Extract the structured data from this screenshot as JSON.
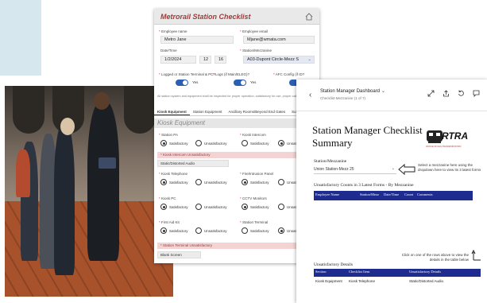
{
  "checklist": {
    "title": "Metrorail Station Checklist",
    "employee_name_label": "Employee name",
    "employee_name": "Metro Jane",
    "employee_email_label": "Employee email",
    "employee_email": "Mjane@wmata.com",
    "datetime_label": "Date/Time",
    "date": "1/2/2024",
    "hour": "12",
    "minute": "16",
    "station_label": "Station/Mezzanine",
    "station": "A03-Dupont Circle-Mezz S",
    "logged_label": "Logged or Station Terminal & PC?",
    "logs_label": "Logs (if Main/ELEG)?",
    "afc_label": "AFC Config (if ID?",
    "yes1": "Yes",
    "yes2": "Yes",
    "note": "All station system and equipment shall be inspected for proper operation, satisfactory for use, proper calibration, and the above.",
    "tabs": [
      "Kiosk Equipment",
      "Station Equipment",
      "Ancillary Rooms/Beyond End Gates",
      "Subst"
    ],
    "section": "Kiosk Equipment",
    "station_pa": "Station PA",
    "kiosk_intercom": "Kiosk Intercom",
    "satisfactory": "Satisfactory",
    "unsatisfactory": "Unsatisfactory",
    "unsat_short": "Unsat",
    "kiosk_intercom_unsat": "Kiosk Intercom Unsatisfactory",
    "kiosk_intercom_unsat_val": "Static/Distorted Audio",
    "kiosk_telephone": "Kiosk Telephone",
    "fire_panel": "Fire/Intrusion Panel",
    "kiosk_pc": "Kiosk PC",
    "cctv": "CCTV Monitors",
    "first_aid": "First Aid Kit",
    "station_terminal": "Station Terminal",
    "station_terminal_unsat": "Station Terminal Unsatisfactory",
    "station_terminal_unsat_val": "Blank Screen"
  },
  "dashboard": {
    "app_title": "Station Manager Dashboard",
    "app_subtitle": "Checklist-Mezzanine (1 of 7)",
    "title_line1": "Station Manager Checklist",
    "title_line2": "Summary",
    "logo_text": "RTRA",
    "logo_sub": "OFFICE OF RAIL TRANSPORTATION",
    "station_label": "Station/Mezzanine",
    "station_value": "Union Station-Mezz 25",
    "hint1": "Select a mezzanine here using the dropdown here to view its 3 latest forms",
    "counts_heading": "Unsatisfactory Counts in 3 Latest Forms - By Mezzanine",
    "counts_cols": [
      "Employee Name",
      "Station/Mezz",
      "Date/Time",
      "Count",
      "Comments"
    ],
    "hint2": "Click on one of the rows above to view the details in the table below",
    "details_heading": "Unsatisfactory Details",
    "details_cols": [
      "Section",
      "Checklist Item",
      "Unsatisfactory Details"
    ],
    "details_row": [
      "Kiosk Equipment",
      "Kiosk Telephone",
      "Static/Distorted Audio"
    ]
  },
  "colors": {
    "accent": "#2a5fb3",
    "header_blue": "#1f2c8f",
    "title_red": "#a23a3a"
  }
}
